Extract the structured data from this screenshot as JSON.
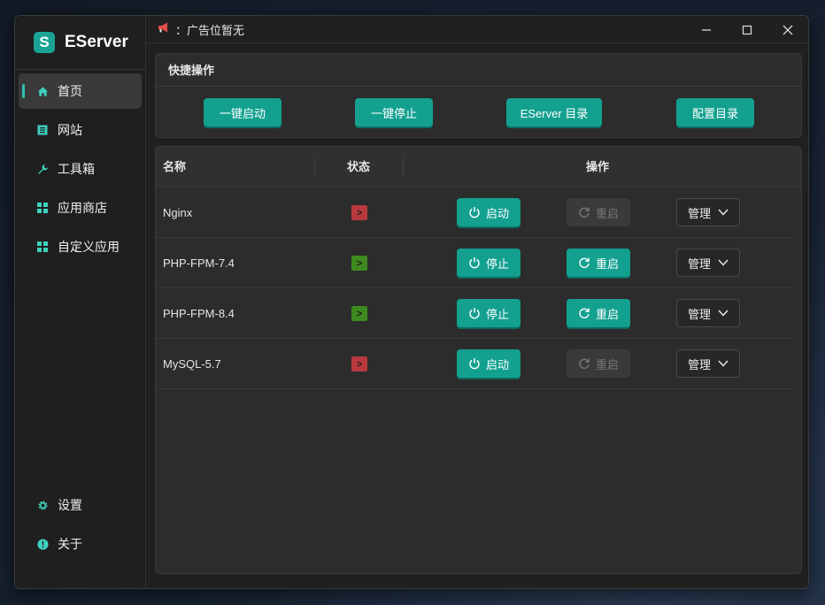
{
  "app": {
    "logo_letter": "S",
    "name": "EServer"
  },
  "sidebar": {
    "items": [
      {
        "label": "首页",
        "icon": "home-icon",
        "active": true
      },
      {
        "label": "网站",
        "icon": "website-icon"
      },
      {
        "label": "工具箱",
        "icon": "wrench-icon"
      },
      {
        "label": "应用商店",
        "icon": "grid-icon"
      },
      {
        "label": "自定义应用",
        "icon": "grid-icon"
      }
    ],
    "bottom": [
      {
        "label": "设置",
        "icon": "gear-icon"
      },
      {
        "label": "关于",
        "icon": "info-icon"
      }
    ]
  },
  "titlebar": {
    "ad_text": "：广告位暂无"
  },
  "quick": {
    "title": "快捷操作",
    "buttons": [
      "一键启动",
      "一键停止",
      "EServer 目录",
      "配置目录"
    ]
  },
  "table": {
    "headers": {
      "name": "名称",
      "status": "状态",
      "action": "操作"
    },
    "rows": [
      {
        "name": "Nginx",
        "status": "stopped",
        "status_glyph": ">",
        "toggle": "启动",
        "restart": "重启",
        "restart_enabled": false,
        "manage": "管理"
      },
      {
        "name": "PHP-FPM-7.4",
        "status": "running",
        "status_glyph": ">",
        "toggle": "停止",
        "restart": "重启",
        "restart_enabled": true,
        "manage": "管理"
      },
      {
        "name": "PHP-FPM-8.4",
        "status": "running",
        "status_glyph": ">",
        "toggle": "停止",
        "restart": "重启",
        "restart_enabled": true,
        "manage": "管理"
      },
      {
        "name": "MySQL-5.7",
        "status": "stopped",
        "status_glyph": ">",
        "toggle": "启动",
        "restart": "重启",
        "restart_enabled": false,
        "manage": "管理"
      }
    ]
  },
  "colors": {
    "accent": "#13a08f",
    "running": "#3d8a1e",
    "stopped": "#b83a3f"
  }
}
